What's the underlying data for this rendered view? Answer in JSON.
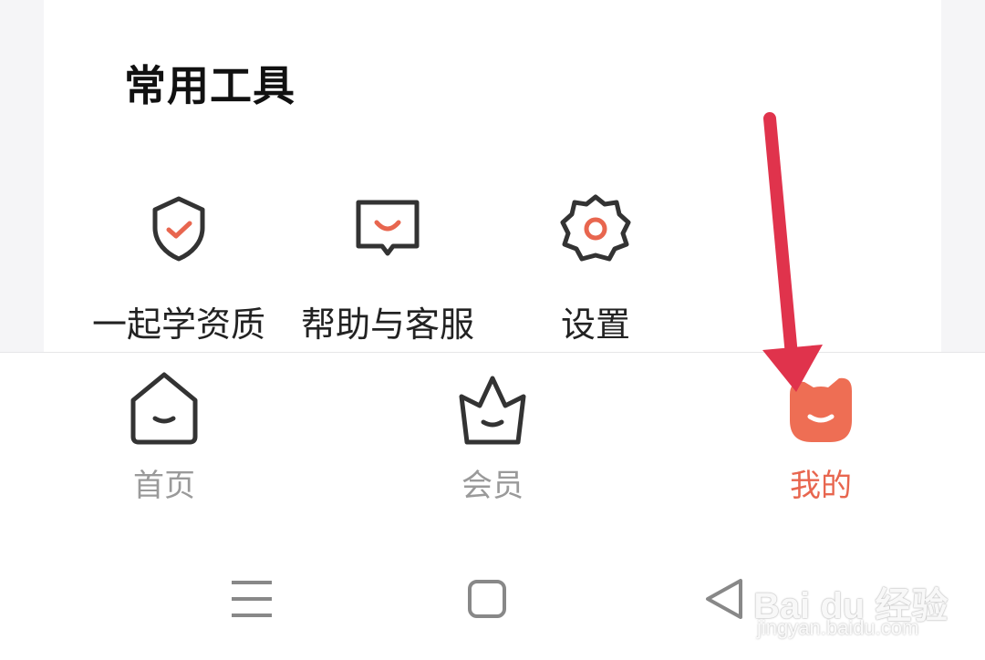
{
  "section": {
    "title": "常用工具"
  },
  "tools": [
    {
      "label": "一起学资质",
      "icon": "shield-check-icon"
    },
    {
      "label": "帮助与客服",
      "icon": "chat-smile-icon"
    },
    {
      "label": "设置",
      "icon": "gear-icon"
    }
  ],
  "tabs": [
    {
      "label": "首页",
      "icon": "home-icon",
      "active": false
    },
    {
      "label": "会员",
      "icon": "crown-icon",
      "active": false
    },
    {
      "label": "我的",
      "icon": "cat-face-icon",
      "active": true
    }
  ],
  "system_nav": [
    "menu-icon",
    "home-square-icon",
    "back-triangle-icon"
  ],
  "watermark": {
    "main": "Bai du 经验",
    "sub": "jingyan.baidu.com"
  },
  "colors": {
    "accent": "#e8664f",
    "annotation": "#e0334c",
    "inactive": "#9a9a9a"
  }
}
